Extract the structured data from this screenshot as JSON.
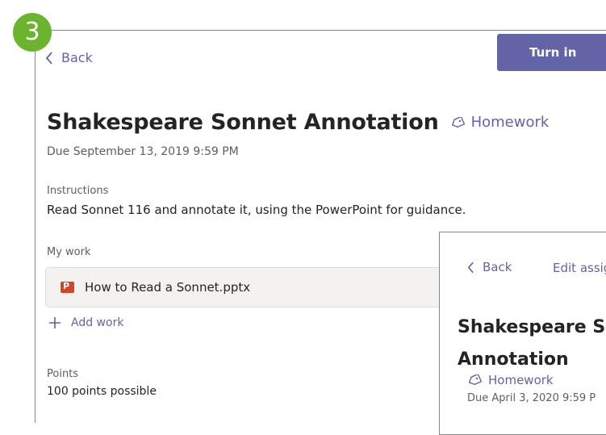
{
  "step": {
    "number": "3"
  },
  "header": {
    "back_label": "Back",
    "turn_in_label": "Turn in"
  },
  "assignment": {
    "title": "Shakespeare Sonnet Annotation",
    "category": "Homework",
    "due": "Due September 13, 2019 9:59 PM",
    "instructions_label": "Instructions",
    "instructions_text": "Read Sonnet 116 and annotate it, using the PowerPoint for guidance.",
    "my_work_label": "My work",
    "attachment_name": "How to Read a Sonnet.pptx",
    "add_work_label": "Add work",
    "points_label": "Points",
    "points_text": "100 points possible"
  },
  "inset": {
    "back_label": "Back",
    "edit_label": "Edit assig",
    "title_line1": "Shakespeare S",
    "title_line2": "Annotation",
    "category": "Homework",
    "due": "Due April 3, 2020 9:59 P"
  },
  "colors": {
    "accent": "#6264a7",
    "badge": "#6bb42e",
    "ppt": "#d24726"
  },
  "icons": [
    "chevron-left-icon",
    "tag-icon",
    "powerpoint-icon",
    "plus-icon"
  ]
}
